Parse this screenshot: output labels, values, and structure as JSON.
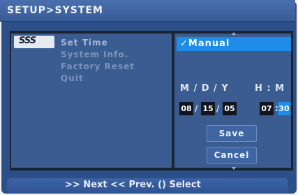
{
  "title": "SETUP>SYSTEM",
  "icon": {
    "name": "system-icon",
    "text": "SSS"
  },
  "menu": [
    "Set Time",
    "System Info.",
    "Factory Reset",
    "Quit"
  ],
  "selected_menu_index": 0,
  "option": {
    "checkmark": "✓",
    "label": "Manual"
  },
  "datetime": {
    "date_header": "M / D / Y",
    "time_header": "H : M",
    "month": "08",
    "day": "15",
    "year": "05",
    "hour": "07",
    "minute": "30",
    "date_separator": "/",
    "time_separator": ":"
  },
  "buttons": {
    "save": "Save",
    "cancel": "Cancel"
  },
  "footer": ">> Next  << Prev.  () Select",
  "colors": {
    "panel": "#3a5c90",
    "highlight": "#1f8ce8",
    "menu_text": "#7b93bd"
  }
}
